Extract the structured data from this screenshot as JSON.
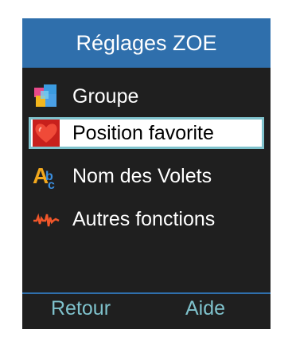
{
  "title": "Réglages ZOE",
  "menu": {
    "items": [
      {
        "label": "Groupe",
        "icon": "group-icon",
        "selected": false
      },
      {
        "label": "Position favorite",
        "icon": "heart-icon",
        "selected": true
      },
      {
        "label": "Nom des Volets",
        "icon": "text-abc-icon",
        "selected": false
      },
      {
        "label": "Autres fonctions",
        "icon": "waveform-icon",
        "selected": false
      }
    ]
  },
  "softkeys": {
    "left_label": "Retour",
    "right_label": "Aide"
  },
  "colors": {
    "title_bar": "#2f6fac",
    "background": "#1f1f1f",
    "selection_border": "#7fc2cc",
    "softkey_text": "#7fc2cc"
  }
}
